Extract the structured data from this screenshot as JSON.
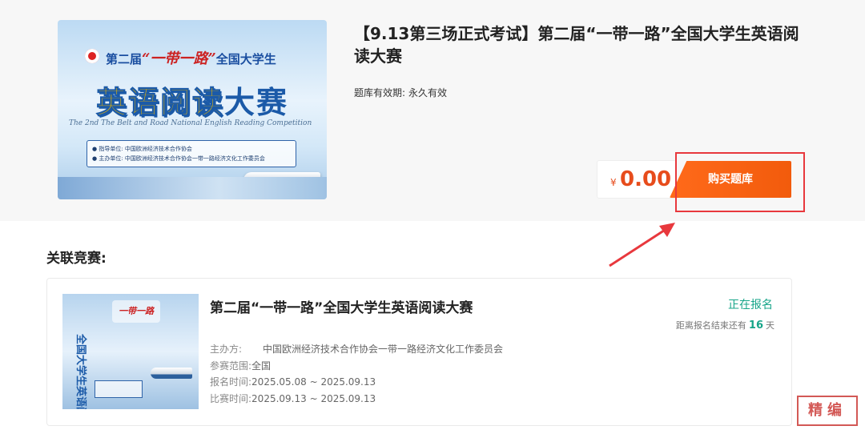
{
  "product": {
    "title": "【9.13第三场正式考试】第二届“一带一路”全国大学生英语阅读大赛",
    "validity_label": "题库有效期:",
    "validity_value": "永久有效",
    "currency": "¥",
    "price": "0.00",
    "buy_button": "购买题库",
    "banner": {
      "top_prefix": "第二届",
      "top_calligraphy": "“一带一路”",
      "top_suffix": "全国大学生",
      "main_a": "英语阅读",
      "main_b": "大赛",
      "english": "The 2nd The Belt and Road National English Reading Competition",
      "guide_line": "● 指导单位: 中国欧洲经济技术合作协会",
      "host_line": "● 主办单位: 中国欧洲经济技术合作协会一带一路经济文化工作委员会"
    }
  },
  "related": {
    "heading": "关联竞赛:",
    "competition": {
      "title": "第二届“一带一路”全国大学生英语阅读大赛",
      "status": "正在报名",
      "countdown_prefix": "距离报名结束还有",
      "countdown_days": "16",
      "countdown_unit": "天",
      "thumb_tag": "一带一路",
      "thumb_text": "全国大学生英语阅读大赛",
      "organizer_label": "主办方:",
      "organizer_value": "中国欧洲经济技术合作协会一带一路经济文化工作委员会",
      "scope_label": "参赛范围:",
      "scope_value": "全国",
      "signup_label": "报名时间:",
      "signup_value": "2025.05.08 ~ 2025.09.13",
      "match_label": "比赛时间:",
      "match_value": "2025.09.13 ~ 2025.09.13"
    }
  },
  "watermark": "精编",
  "colors": {
    "accent_orange": "#f25b0c",
    "price_red": "#e74c1c",
    "highlight_red": "#e8383d",
    "status_green": "#17a589"
  }
}
